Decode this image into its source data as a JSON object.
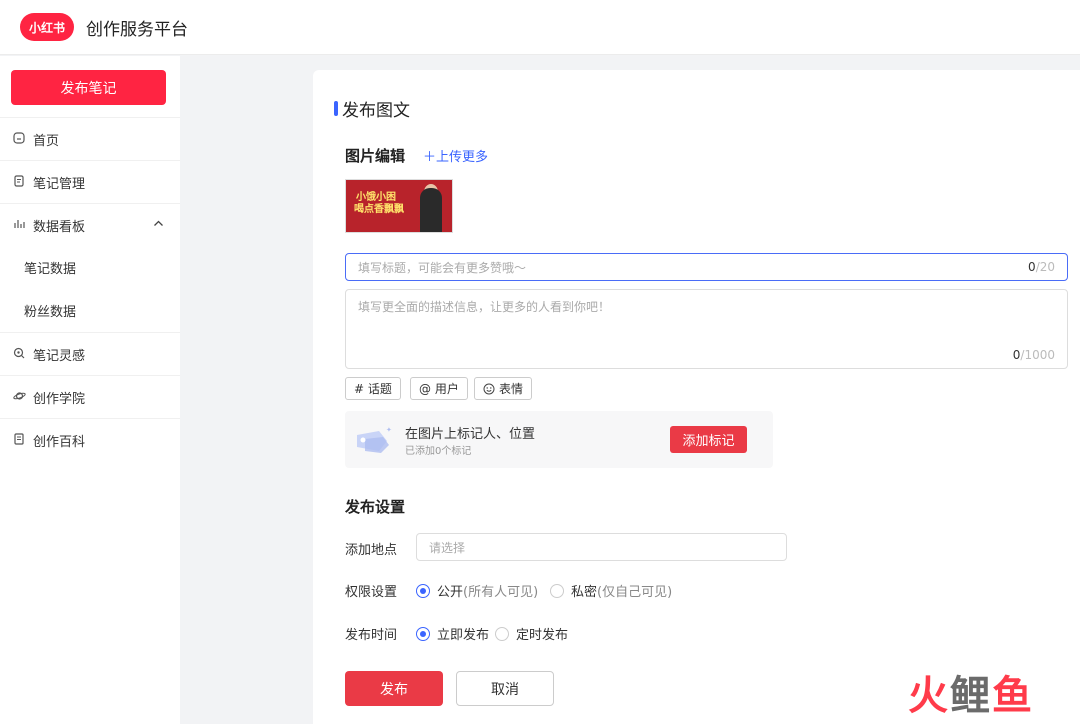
{
  "header": {
    "logo_text": "小红书",
    "app_title": "创作服务平台"
  },
  "sidebar": {
    "publish_label": "发布笔记",
    "items": [
      {
        "label": "首页",
        "icon": "home-icon"
      },
      {
        "label": "笔记管理",
        "icon": "note-icon"
      },
      {
        "label": "数据看板",
        "icon": "chart-icon"
      },
      {
        "label": "笔记数据"
      },
      {
        "label": "粉丝数据"
      },
      {
        "label": "笔记灵感",
        "icon": "inspiration-icon"
      },
      {
        "label": "创作学院",
        "icon": "planet-icon"
      },
      {
        "label": "创作百科",
        "icon": "book-icon"
      }
    ]
  },
  "main": {
    "page_title": "发布图文",
    "image_section": {
      "title": "图片编辑",
      "upload_more": "上传更多",
      "thumb_line1": "小饿小困",
      "thumb_line2": "喝点香飘飘"
    },
    "title_input": {
      "placeholder": "填写标题，可能会有更多赞哦～",
      "count": "0",
      "max": "/20"
    },
    "desc_input": {
      "placeholder": "填写更全面的描述信息，让更多的人看到你吧！",
      "count": "0",
      "max": "/1000"
    },
    "tags": {
      "topic": "# 话题",
      "user": "@ 用户",
      "emoji": "表情"
    },
    "mark": {
      "title": "在图片上标记人、位置",
      "subtitle": "已添加0个标记",
      "button": "添加标记"
    },
    "settings": {
      "title": "发布设置",
      "location_label": "添加地点",
      "location_placeholder": "请选择",
      "permission_label": "权限设置",
      "permission_public": "公开",
      "permission_public_note": "(所有人可见)",
      "permission_private": "私密",
      "permission_private_note": "(仅自己可见)",
      "time_label": "发布时间",
      "time_now": "立即发布",
      "time_scheduled": "定时发布"
    },
    "actions": {
      "submit": "发布",
      "cancel": "取消"
    }
  },
  "watermark": {
    "char1": "火",
    "char2": "鲤",
    "char3": "鱼"
  },
  "colors": {
    "brand_red": "#ff2442",
    "accent_blue": "#3a64ff"
  }
}
